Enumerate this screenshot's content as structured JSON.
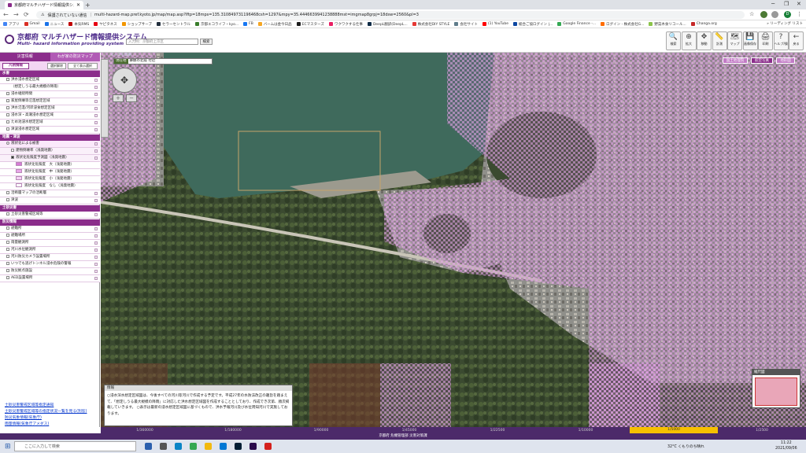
{
  "browser": {
    "tab_title": "京都府マルチハザード情報提供システム",
    "new_tab": "+",
    "not_secure": "保護されていない通信",
    "url": "multi-hazard-map.pref.kyoto.jp/map/map.asp?lftp=18mps=135.310849731196468csh=1297&mpy=35.4446639941238888mst=imgmap8grpj=18dsw=2560&pl=3",
    "user_initial": "D"
  },
  "bookmarks": [
    {
      "label": "アプリ",
      "color": "#4285f4"
    },
    {
      "label": "Gmail",
      "color": "#d93025"
    },
    {
      "label": "ニュース",
      "color": "#1a73e8"
    },
    {
      "label": "本気RMS",
      "color": "#bf0000"
    },
    {
      "label": "ヤピタネス",
      "color": "#e60012"
    },
    {
      "label": "ショップサーブ",
      "color": "#f29600"
    },
    {
      "label": "セラーセントラル",
      "color": "#232f3e"
    },
    {
      "label": "京都エコライフ・kyo...",
      "color": "#3a7d2c"
    },
    {
      "label": "FB",
      "color": "#1877f2"
    },
    {
      "label": "バームは金今日品",
      "color": "#f5a623"
    },
    {
      "label": "ECマスターズ",
      "color": "#1c1c1c"
    },
    {
      "label": "ワクワクする仕事",
      "color": "#e91e63"
    },
    {
      "label": "DeepL翻訳(DeepL...",
      "color": "#0f2b46"
    },
    {
      "label": "株式会社DIY STYLE",
      "color": "#e53935"
    },
    {
      "label": "会社サイト",
      "color": "#607d8b"
    },
    {
      "label": "(1) YouTube",
      "color": "#ff0000"
    },
    {
      "label": "総合ご協ログイン |...",
      "color": "#0d47a1"
    },
    {
      "label": "Google Finance -...",
      "color": "#34a853"
    },
    {
      "label": "ログイン - 株式会社G...",
      "color": "#ff6d00"
    },
    {
      "label": "野菜木食リコール...",
      "color": "#8bc34a"
    },
    {
      "label": "Changa.org",
      "color": "#c62828"
    }
  ],
  "bookmarks_more": "»",
  "reading_list": "リーディング リスト",
  "header": {
    "title": "京都府 マルチハザード情報提供システム",
    "subtitle": "Multi- hazard information providing system",
    "search_placeholder": "入力例：京都府上京区",
    "search_button": "検索",
    "toolbar": [
      {
        "label": "検索",
        "icon": "🔍"
      },
      {
        "label": "拡大",
        "icon": "⊕"
      },
      {
        "label": "移動",
        "icon": "✥"
      },
      {
        "label": "計測",
        "icon": "📏"
      },
      {
        "label": "マップ",
        "icon": "🗺"
      },
      {
        "label": "画像保存",
        "icon": "💾"
      },
      {
        "label": "印刷",
        "icon": "🖨"
      },
      {
        "label": "ヘルプ/操作",
        "icon": "?"
      },
      {
        "label": "戻る",
        "icon": "←"
      }
    ]
  },
  "panel": {
    "tab_active": "災害情報",
    "tab_other": "わが家の防災マップ",
    "info_button": "凡例情報",
    "clear_button": "選択解除",
    "all_button": "全て表示選択",
    "sections": [
      {
        "title": "水害",
        "rows": [
          {
            "label": "洪水浸水想定区域",
            "checked": false
          },
          {
            "label": "（想定しうる最大規模の降雨）",
            "checked": false,
            "indent": true
          },
          {
            "label": "浸水継続時間",
            "checked": false
          },
          {
            "label": "家屋倒壊等氾濫想定区域",
            "checked": false
          },
          {
            "label": "洪水氾濫/河岸浸食想定区域",
            "checked": false
          },
          {
            "label": "浸水深・高潮浸水想定区域",
            "checked": false
          },
          {
            "label": "ため池浸水想定区域",
            "checked": false
          },
          {
            "label": "津波浸水想定区域",
            "checked": false
          }
        ]
      },
      {
        "title": "地震・津波",
        "rows": [
          {
            "label": "液状化による被害",
            "checked": false,
            "radio": true
          },
          {
            "label": "建物倒壊率（浅発地震）",
            "checked": false,
            "sub": true
          },
          {
            "label": "液状化危険度予測図（浅発地震）",
            "checked": true,
            "sub": true
          },
          {
            "label": "液状化危険度　大（浅発地震）",
            "swatch": "#d67ad6"
          },
          {
            "label": "液状化危険度　中（浅発地震）",
            "swatch": "#e9a6e9"
          },
          {
            "label": "液状化危険度　小（浅発地震）",
            "swatch": "#f4d2f4"
          },
          {
            "label": "液状化危険度　なし（浅発地震）",
            "swatch": "#ffffff"
          },
          {
            "label": "活断層マップの活断層",
            "checked": false
          },
          {
            "label": "津波",
            "checked": false
          }
        ]
      },
      {
        "title": "土砂災害",
        "rows": [
          {
            "label": "土砂災害警戒区域等",
            "checked": false
          }
        ]
      },
      {
        "title": "防災情報",
        "rows": [
          {
            "label": "避難所",
            "checked": false
          },
          {
            "label": "避難場所",
            "checked": false
          },
          {
            "label": "雨量観測所",
            "checked": false
          },
          {
            "label": "河川水位観測所",
            "checked": false
          },
          {
            "label": "河川防災カメラ設置場所",
            "checked": false
          },
          {
            "label": "いつでも逃げトンネル浸水危険の警報",
            "checked": false
          },
          {
            "label": "防災拠点施設",
            "checked": false
          },
          {
            "label": "AED設置場所",
            "checked": false
          }
        ]
      }
    ],
    "bottom_links": [
      "土砂災害警戒区域等指定通知",
      "土砂災害警戒区域等の指定状況一覧を見る(別窓)",
      "防災気象情報(気象庁)",
      "雨量情報(気象庁アメダス)"
    ]
  },
  "map": {
    "location_key": "現在地",
    "location_value": "舞鶴市北吸 付近",
    "top_link": "マップを印刷",
    "buttons": [
      "国土地理院",
      "航空写真",
      "地形図"
    ],
    "active_button": 1,
    "zoom_in": "＋",
    "zoom_out": "－",
    "infobox_title": "情報",
    "infobox_text": "○浸水深水想定区域図は、今後すべての河川等河川で作成する予定です。平成27年の水防法改正の趣旨を踏まえて、「想定しうる最大規模の降雨」に対応した洪水想定区域図を作成することとしており、作成でき次第、順次掲載していきます。 ○表示は最新の浸水想定区域図に基づくもので、洪水予報河川及び水位周知河川で実施しております。",
    "minimap_title": "縮尺図"
  },
  "scale": {
    "labels": [
      "1/360000",
      "1/180000",
      "1/90000",
      "1/45000",
      "1/22500",
      "1/10000",
      "1/5000",
      "1/2500"
    ],
    "active": 6
  },
  "footer": "京都府 危機管理部 災害対策課",
  "taskbar": {
    "search_placeholder": "ここに入力して検索",
    "weather": "32°C くもりのち晴れ",
    "time": "11:22",
    "date": "2021/09/06",
    "icons": [
      {
        "name": "cortana",
        "color": "#2b5fad"
      },
      {
        "name": "task-view",
        "color": "#555555"
      },
      {
        "name": "edge",
        "color": "#0a84c6"
      },
      {
        "name": "chrome",
        "color": "#34a853"
      },
      {
        "name": "explorer",
        "color": "#f2b90f"
      },
      {
        "name": "mail",
        "color": "#0078d4"
      },
      {
        "name": "photoshop",
        "color": "#001d34"
      },
      {
        "name": "premiere",
        "color": "#2a0b4b"
      },
      {
        "name": "acrobat",
        "color": "#d4201c"
      }
    ]
  }
}
